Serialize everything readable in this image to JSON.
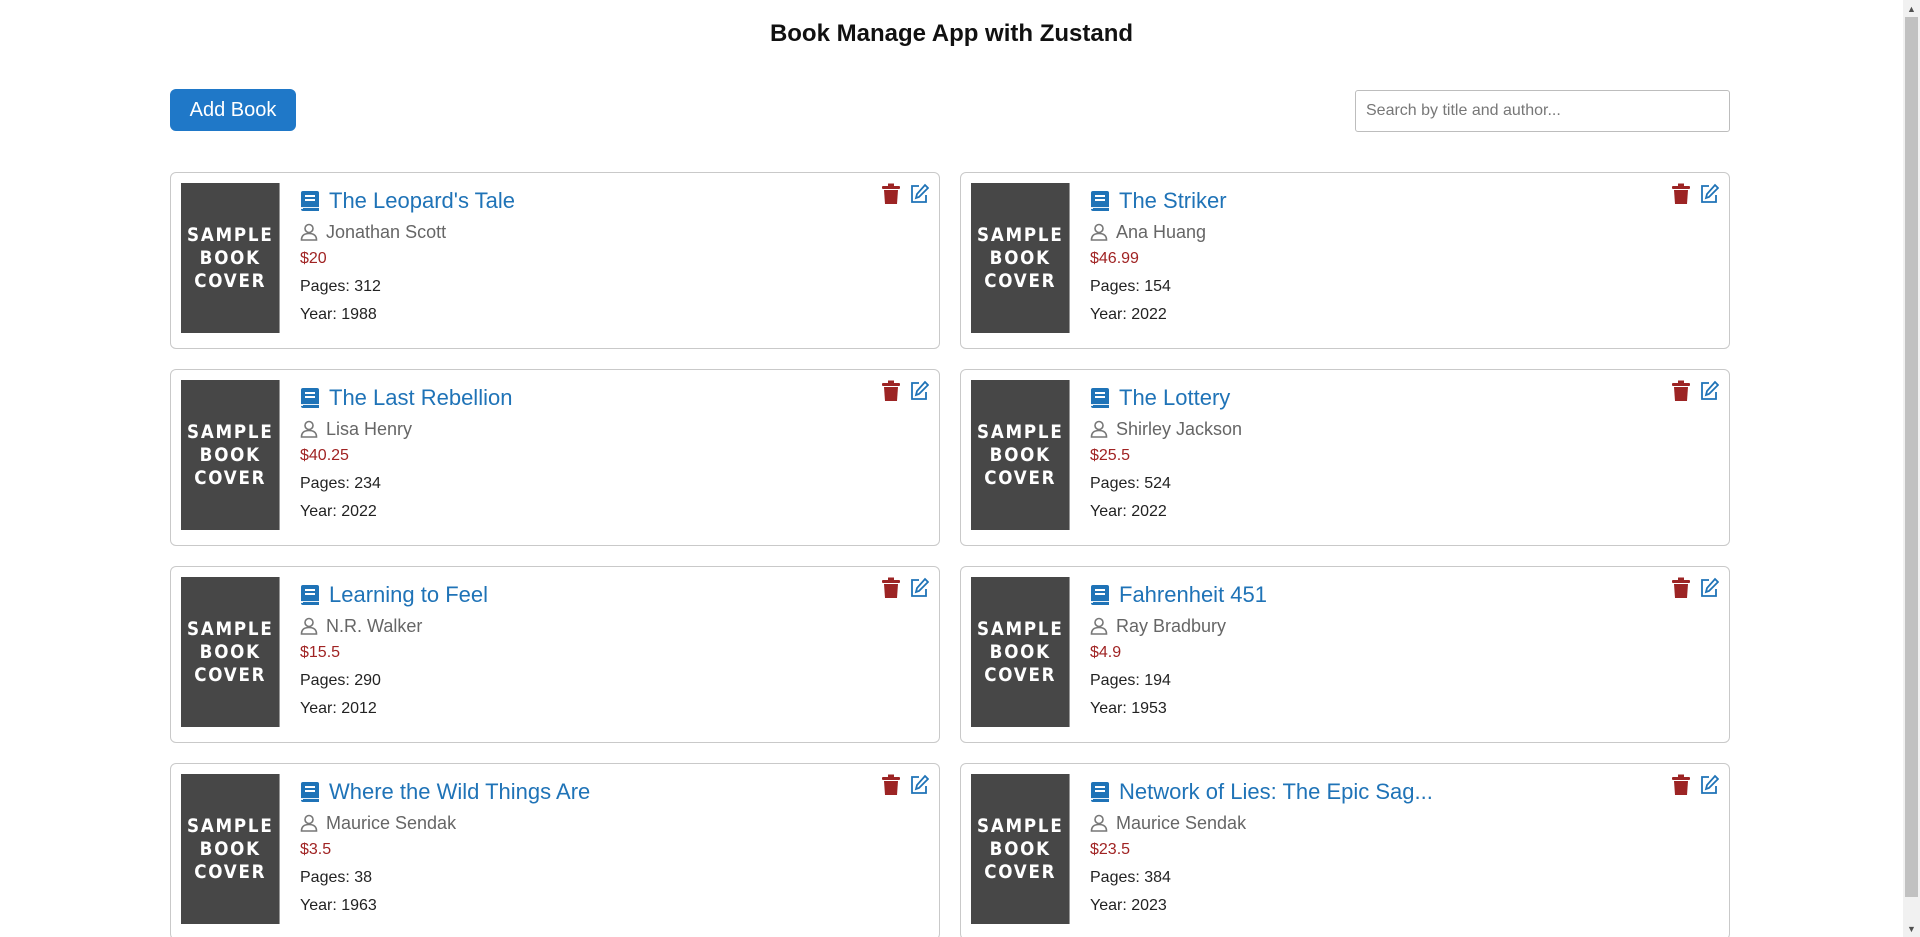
{
  "app": {
    "title": "Book Manage App with Zustand"
  },
  "toolbar": {
    "add_label": "Add Book",
    "search_placeholder": "Search by title and author...",
    "search_value": ""
  },
  "colors": {
    "accent": "#1f78c8",
    "title": "#1f73b7",
    "price": "#a02323",
    "delete": "#9c2424",
    "cover": "#474747"
  },
  "cover_text": [
    "SAMPLE",
    "BOOK",
    "COVER"
  ],
  "books": [
    {
      "title": "The Leopard's Tale",
      "author": "Jonathan Scott",
      "price": "$20",
      "pages": "Pages: 312",
      "year": "Year: 1988"
    },
    {
      "title": "The Striker",
      "author": "Ana Huang",
      "price": "$46.99",
      "pages": "Pages: 154",
      "year": "Year: 2022"
    },
    {
      "title": "The Last Rebellion",
      "author": "Lisa Henry",
      "price": "$40.25",
      "pages": "Pages: 234",
      "year": "Year: 2022"
    },
    {
      "title": "The Lottery",
      "author": "Shirley Jackson",
      "price": "$25.5",
      "pages": "Pages: 524",
      "year": "Year: 2022"
    },
    {
      "title": "Learning to Feel",
      "author": "N.R. Walker",
      "price": "$15.5",
      "pages": "Pages: 290",
      "year": "Year: 2012"
    },
    {
      "title": "Fahrenheit 451",
      "author": "Ray Bradbury",
      "price": "$4.9",
      "pages": "Pages: 194",
      "year": "Year: 1953"
    },
    {
      "title": "Where the Wild Things Are",
      "author": "Maurice Sendak",
      "price": "$3.5",
      "pages": "Pages: 38",
      "year": "Year: 1963"
    },
    {
      "title": "Network of Lies: The Epic Sag...",
      "author": "Maurice Sendak",
      "price": "$23.5",
      "pages": "Pages: 384",
      "year": "Year: 2023"
    }
  ],
  "icons": {
    "book": "book-icon",
    "author": "user-icon",
    "delete": "trash-icon",
    "edit": "edit-icon"
  }
}
